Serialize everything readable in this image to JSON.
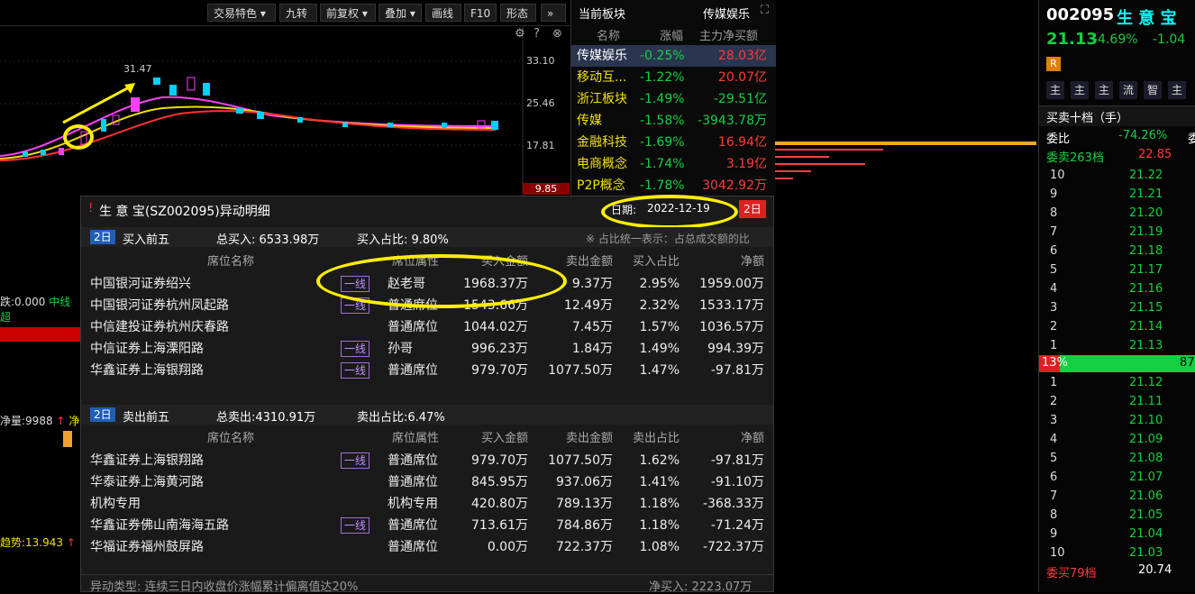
{
  "toolbar": {
    "items": [
      "交易特色",
      "九转",
      "前复权",
      "叠加",
      "画线",
      "F10",
      "形态",
      "»"
    ]
  },
  "chart": {
    "price_labels": [
      "33.10",
      "25.46",
      "17.81",
      "9.85"
    ],
    "peak_label": "31.47",
    "side_labels": {
      "a": "跌:0.000",
      "b": "中线超",
      "c": "净量:9988",
      "d": "净",
      "e": "趋势:13.943"
    }
  },
  "sector": {
    "title": "当前板块",
    "current": "传媒娱乐",
    "headers": [
      "名称",
      "涨幅",
      "主力净买额"
    ],
    "rows": [
      {
        "name": "传媒娱乐",
        "change": "-0.25%",
        "net": "28.03亿",
        "net_color": "red"
      },
      {
        "name": "移动互...",
        "change": "-1.22%",
        "net": "20.07亿",
        "net_color": "red"
      },
      {
        "name": "浙江板块",
        "change": "-1.49%",
        "net": "-29.51亿",
        "net_color": "green"
      },
      {
        "name": "传媒",
        "change": "-1.58%",
        "net": "-3943.78万",
        "net_color": "green"
      },
      {
        "name": "金融科技",
        "change": "-1.69%",
        "net": "16.94亿",
        "net_color": "red"
      },
      {
        "name": "电商概念",
        "change": "-1.74%",
        "net": "3.19亿",
        "net_color": "red"
      },
      {
        "name": "P2P概念",
        "change": "-1.78%",
        "net": "3042.92万",
        "net_color": "red"
      }
    ]
  },
  "quote": {
    "code": "002095",
    "name": "生 意 宝",
    "price": "21.13",
    "change_pct": "-4.69%",
    "change": "-1.04",
    "r_badge": "R",
    "tabs": [
      "主",
      "主",
      "主",
      "流",
      "智",
      "主"
    ],
    "book_title": "买卖十档（手）",
    "weibi_label": "委比",
    "weibi_value": "-74.26%",
    "weicha_label": "委",
    "sell_label": "委卖263档",
    "sell_price": "22.85",
    "asks": [
      {
        "level": "10",
        "price": "21.22"
      },
      {
        "level": "9",
        "price": "21.21"
      },
      {
        "level": "8",
        "price": "21.20"
      },
      {
        "level": "7",
        "price": "21.19"
      },
      {
        "level": "6",
        "price": "21.18"
      },
      {
        "level": "5",
        "price": "21.17"
      },
      {
        "level": "4",
        "price": "21.16"
      },
      {
        "level": "3",
        "price": "21.15"
      },
      {
        "level": "2",
        "price": "21.14"
      },
      {
        "level": "1",
        "price": "21.13"
      }
    ],
    "ratio_left": "13%",
    "ratio_right": "87",
    "ratio_left_fraction": 0.13,
    "bids": [
      {
        "level": "1",
        "price": "21.12"
      },
      {
        "level": "2",
        "price": "21.11"
      },
      {
        "level": "3",
        "price": "21.10"
      },
      {
        "level": "4",
        "price": "21.09"
      },
      {
        "level": "5",
        "price": "21.08"
      },
      {
        "level": "6",
        "price": "21.07"
      },
      {
        "level": "7",
        "price": "21.06"
      },
      {
        "level": "8",
        "price": "21.05"
      },
      {
        "level": "9",
        "price": "21.04"
      },
      {
        "level": "10",
        "price": "21.03"
      }
    ],
    "buy_label": "委买79档",
    "buy_price": "20.74"
  },
  "popup": {
    "title": "生 意 宝(SZ002095)异动明细",
    "date_label": "日期:",
    "date_value": "2022-12-19",
    "day_button": "2日",
    "note": "※ 占比统一表示：占总成交额的比",
    "buy": {
      "badge": "2日",
      "title": "买入前五",
      "total": "总买入: 6533.98万",
      "ratio": "买入占比: 9.80%",
      "headers": [
        "席位名称",
        "席位属性",
        "买入金额",
        "卖出金额",
        "买入占比",
        "净额"
      ],
      "rows": [
        {
          "name": "中国银河证券绍兴",
          "tag": "一线",
          "attr": "赵老哥",
          "buy": "1968.37万",
          "sell": "9.37万",
          "pct": "2.95%",
          "net": "1959.00万"
        },
        {
          "name": "中国银河证券杭州凤起路",
          "tag": "一线",
          "attr": "普通席位",
          "buy": "1543.66万",
          "sell": "12.49万",
          "pct": "2.32%",
          "net": "1533.17万"
        },
        {
          "name": "中信建投证券杭州庆春路",
          "tag": "",
          "attr": "普通席位",
          "buy": "1044.02万",
          "sell": "7.45万",
          "pct": "1.57%",
          "net": "1036.57万"
        },
        {
          "name": "中信证券上海溧阳路",
          "tag": "一线",
          "attr": "孙哥",
          "buy": "996.23万",
          "sell": "1.84万",
          "pct": "1.49%",
          "net": "994.39万"
        },
        {
          "name": "华鑫证券上海银翔路",
          "tag": "一线",
          "attr": "普通席位",
          "buy": "979.70万",
          "sell": "1077.50万",
          "pct": "1.47%",
          "net": "-97.81万"
        }
      ]
    },
    "sell": {
      "badge": "2日",
      "title": "卖出前五",
      "total": "总卖出:4310.91万",
      "ratio": "卖出占比:6.47%",
      "headers": [
        "席位名称",
        "席位属性",
        "买入金额",
        "卖出金额",
        "卖出占比",
        "净额"
      ],
      "rows": [
        {
          "name": "华鑫证券上海银翔路",
          "tag": "一线",
          "attr": "普通席位",
          "buy": "979.70万",
          "sell": "1077.50万",
          "pct": "1.62%",
          "net": "-97.81万"
        },
        {
          "name": "华泰证券上海黄河路",
          "tag": "",
          "attr": "普通席位",
          "buy": "845.95万",
          "sell": "937.06万",
          "pct": "1.41%",
          "net": "-91.10万"
        },
        {
          "name": "机构专用",
          "tag": "",
          "attr": "机构专用",
          "buy": "420.80万",
          "sell": "789.13万",
          "pct": "1.18%",
          "net": "-368.33万"
        },
        {
          "name": "华鑫证券佛山南海海五路",
          "tag": "一线",
          "attr": "普通席位",
          "buy": "713.61万",
          "sell": "784.86万",
          "pct": "1.18%",
          "net": "-71.24万"
        },
        {
          "name": "华福证券福州鼓屏路",
          "tag": "",
          "attr": "普通席位",
          "buy": "0.00万",
          "sell": "722.37万",
          "pct": "1.08%",
          "net": "-722.37万"
        }
      ]
    },
    "footer_type": "异动类型: 连续三日内收盘价涨幅累计偏离值达20%",
    "footer_net": "净买入: 2223.07万"
  }
}
